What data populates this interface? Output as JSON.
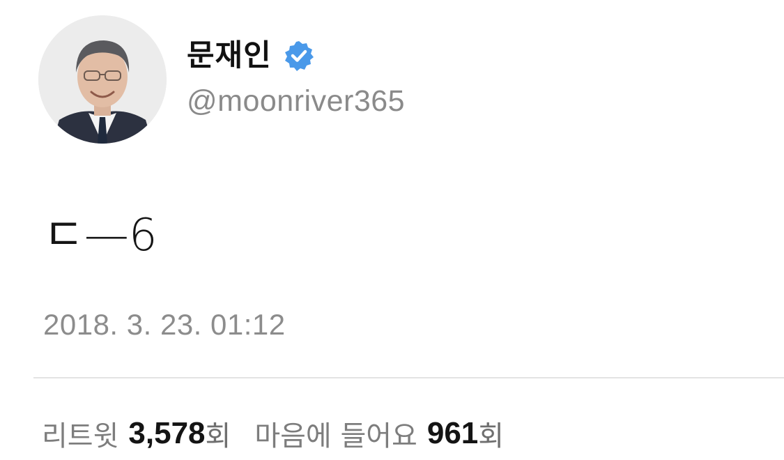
{
  "user": {
    "display_name": "문재인",
    "handle": "@moonriver365",
    "verified": true,
    "verified_color": "#4a99e9",
    "avatar_icon": "profile-photo"
  },
  "tweet": {
    "text": "ㄷ—6",
    "timestamp": "2018. 3. 23. 01:12"
  },
  "stats": {
    "retweets": {
      "label": "리트윗",
      "count": "3,578",
      "unit": "회"
    },
    "likes": {
      "label": "마음에 들어요",
      "count": "961",
      "unit": "회"
    }
  }
}
